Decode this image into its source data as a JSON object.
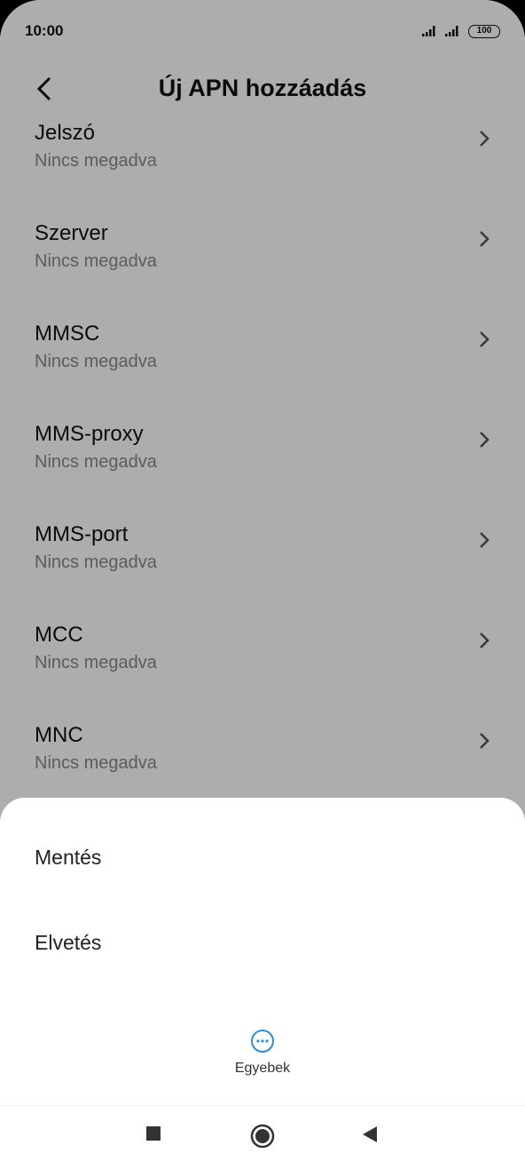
{
  "status": {
    "time": "10:00",
    "battery": "100"
  },
  "header": {
    "title": "Új APN hozzáadás"
  },
  "settings": [
    {
      "label": "Jelszó",
      "value": "Nincs megadva"
    },
    {
      "label": "Szerver",
      "value": "Nincs megadva"
    },
    {
      "label": "MMSC",
      "value": "Nincs megadva"
    },
    {
      "label": "MMS-proxy",
      "value": "Nincs megadva"
    },
    {
      "label": "MMS-port",
      "value": "Nincs megadva"
    },
    {
      "label": "MCC",
      "value": "Nincs megadva"
    },
    {
      "label": "MNC",
      "value": "Nincs megadva"
    }
  ],
  "sheet": {
    "save_label": "Mentés",
    "discard_label": "Elvetés",
    "more_label": "Egyebek"
  },
  "colors": {
    "accent": "#2a8fd8",
    "scrim": "#000000"
  }
}
